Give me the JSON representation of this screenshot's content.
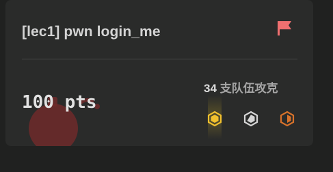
{
  "challenge": {
    "title": "[lec1] pwn login_me",
    "points_label": "100 pts",
    "solves_count": "34",
    "solves_label": "支队伍攻克"
  },
  "badges": [
    {
      "name": "gold-badge-icon",
      "color": "#f2c12e"
    },
    {
      "name": "silver-badge-icon",
      "color": "#d6d6d6"
    },
    {
      "name": "bronze-badge-icon",
      "color": "#d8722a"
    }
  ],
  "colors": {
    "flag": "#f07070",
    "watermark": "#7a2f2f",
    "background": "#202120",
    "card": "#2a2b2a"
  }
}
